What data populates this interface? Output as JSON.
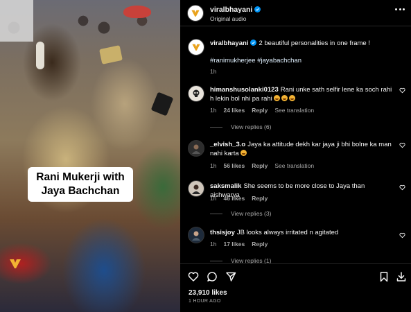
{
  "media": {
    "caption": "Rani Mukerji with Jaya Bachchan"
  },
  "header": {
    "username": "viralbhayani",
    "subtitle": "Original audio"
  },
  "post": {
    "username": "viralbhayani",
    "caption": "2 beautiful personalities in one frame !",
    "hashtags": "#ranimukherjee #jayabachchan",
    "time": "1h"
  },
  "comments": [
    {
      "username": "himanshusolanki0123",
      "text": "Rani unke sath selfir lene ka soch rahi h lekin bol nhi pa rahi",
      "emoji_count": 3,
      "time": "1h",
      "likes": "24 likes",
      "reply": "Reply",
      "translate": "See translation",
      "replies": "View replies (6)"
    },
    {
      "username": "_elvish_3.o",
      "text": "Jaya ka attitude dekh kar jaya ji bhi bolne ka man nahi karta",
      "emoji_count": 1,
      "time": "1h",
      "likes": "56 likes",
      "reply": "Reply",
      "translate": "See translation",
      "replies": ""
    },
    {
      "username": "saksmalik",
      "text": "She seems to be more close to Jaya than aishwarya",
      "emoji_count": 0,
      "time": "1h",
      "likes": "46 likes",
      "reply": "Reply",
      "translate": "",
      "replies": "View replies (3)"
    },
    {
      "username": "thsisjoy",
      "text": "JB looks always irritated n agitated",
      "emoji_count": 0,
      "time": "1h",
      "likes": "17 likes",
      "reply": "Reply",
      "translate": "",
      "replies": "View replies (1)"
    }
  ],
  "footer": {
    "likes": "23,910 likes",
    "time": "1 HOUR AGO"
  },
  "icons": {
    "verified": "verified-badge-icon",
    "like": "heart-icon",
    "comment": "comment-bubble-icon",
    "share": "paper-plane-icon",
    "save": "bookmark-icon",
    "download": "download-icon",
    "more": "more-dots-icon"
  },
  "colors": {
    "background": "#000000",
    "text": "#f5f5f5",
    "muted": "#a8a8a8",
    "verified": "#0095f6"
  }
}
